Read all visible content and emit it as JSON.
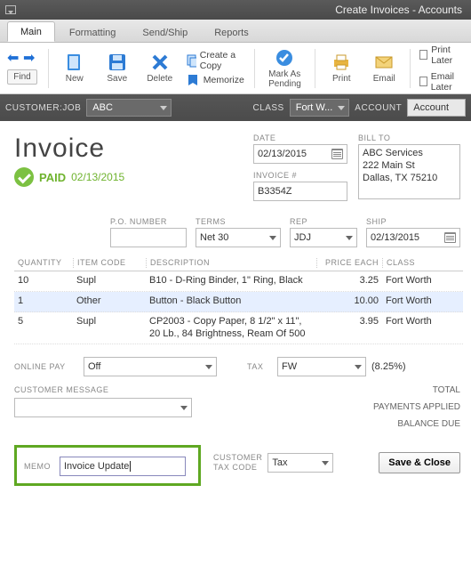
{
  "window": {
    "title": "Create Invoices - Accounts"
  },
  "tabs": {
    "main": "Main",
    "formatting": "Formatting",
    "sendship": "Send/Ship",
    "reports": "Reports"
  },
  "ribbon": {
    "find": "Find",
    "new": "New",
    "save": "Save",
    "delete": "Delete",
    "create_copy": "Create a Copy",
    "memorize": "Memorize",
    "mark_pending_l1": "Mark As",
    "mark_pending_l2": "Pending",
    "print": "Print",
    "email": "Email",
    "print_later": "Print Later",
    "email_later": "Email Later"
  },
  "context": {
    "customerjob_label": "CUSTOMER:JOB",
    "customerjob": "ABC",
    "class_label": "CLASS",
    "class": "Fort W...",
    "account_label": "ACCOUNT",
    "account": "Account"
  },
  "header": {
    "title": "Invoice",
    "paid_label": "PAID",
    "paid_date": "02/13/2015",
    "date_label": "DATE",
    "date": "02/13/2015",
    "invoice_no_label": "INVOICE #",
    "invoice_no": "B3354Z",
    "billto_label": "BILL TO",
    "billto_l1": "ABC Services",
    "billto_l2": "222 Main St",
    "billto_l3": "Dallas, TX 75210"
  },
  "row2": {
    "po_label": "P.O. NUMBER",
    "po": "",
    "terms_label": "TERMS",
    "terms": "Net 30",
    "rep_label": "REP",
    "rep": "JDJ",
    "ship_label": "SHIP",
    "ship": "02/13/2015"
  },
  "table": {
    "h_qty": "QUANTITY",
    "h_item": "ITEM CODE",
    "h_desc": "DESCRIPTION",
    "h_price": "PRICE EACH",
    "h_class": "CLASS",
    "r0": {
      "qty": "10",
      "item": "Supl",
      "desc": "B10 - D-Ring Binder, 1\" Ring, Black",
      "price": "3.25",
      "class": "Fort Worth"
    },
    "r1": {
      "qty": "1",
      "item": "Other",
      "desc": "Button - Black Button",
      "price": "10.00",
      "class": "Fort Worth"
    },
    "r2": {
      "qty": "5",
      "item": "Supl",
      "desc": "CP2003 - Copy Paper, 8 1/2\" x 11\", 20 Lb., 84 Brightness, Ream Of 500",
      "price": "3.95",
      "class": "Fort Worth"
    }
  },
  "lower": {
    "onlinepay_label": "ONLINE PAY",
    "onlinepay": "Off",
    "custmsg_label": "CUSTOMER MESSAGE",
    "tax_label": "TAX",
    "tax_code": "FW",
    "tax_pct": "(8.25%)",
    "total_label": "TOTAL",
    "payments_label": "PAYMENTS APPLIED",
    "balance_label": "BALANCE DUE",
    "memo_label": "MEMO",
    "memo": "Invoice Update",
    "cust_taxcode_l1": "CUSTOMER",
    "cust_taxcode_l2": "TAX CODE",
    "cust_taxcode": "Tax",
    "save_close": "Save & Close"
  }
}
